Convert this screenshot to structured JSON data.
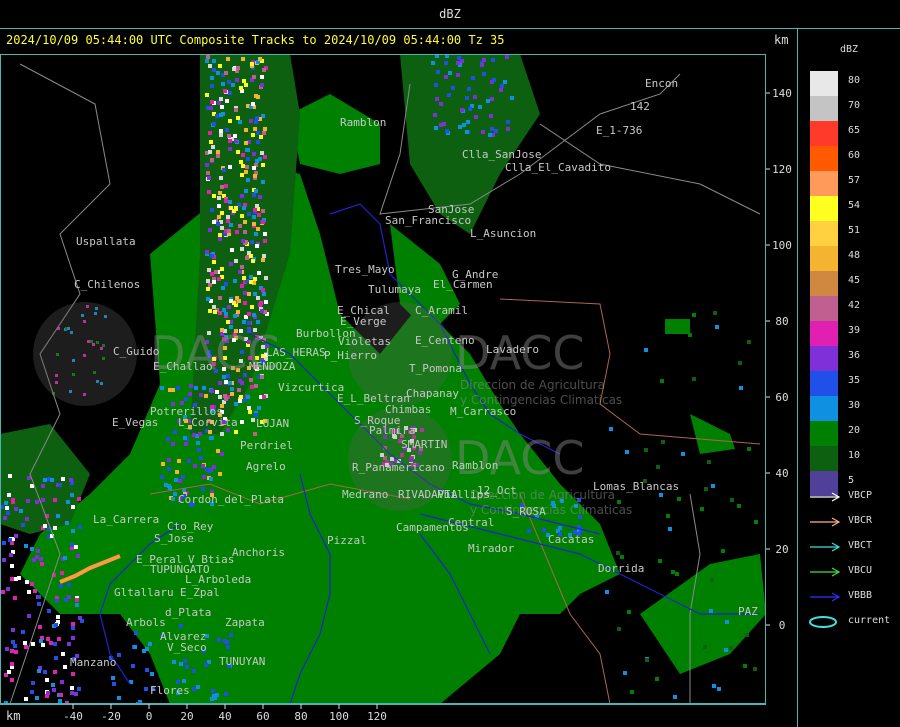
{
  "window": {
    "title": "dBZ"
  },
  "header": {
    "subtitle": "2024/10/09 05:44:00 UTC Composite Tracks to 2024/10/09 05:44:00 Tz 35",
    "km_top": "km",
    "km_bottom": "km"
  },
  "axes": {
    "x_ticks": [
      "-40",
      "-20",
      "0",
      "20",
      "40",
      "60",
      "80",
      "100",
      "120"
    ],
    "y_ticks": [
      "140",
      "120",
      "100",
      "80",
      "60",
      "40",
      "20",
      "0"
    ]
  },
  "legend": {
    "title": "dBZ",
    "scale": [
      {
        "label": "80",
        "color": "#e8e8e8"
      },
      {
        "label": "70",
        "color": "#c4c4c4"
      },
      {
        "label": "65",
        "color": "#ff3a2a"
      },
      {
        "label": "60",
        "color": "#ff5a00"
      },
      {
        "label": "57",
        "color": "#ff9a5a"
      },
      {
        "label": "54",
        "color": "#ffff20"
      },
      {
        "label": "51",
        "color": "#ffd040"
      },
      {
        "label": "48",
        "color": "#f4b430"
      },
      {
        "label": "45",
        "color": "#d08840"
      },
      {
        "label": "42",
        "color": "#c06090"
      },
      {
        "label": "39",
        "color": "#e020b0"
      },
      {
        "label": "36",
        "color": "#8030d8"
      },
      {
        "label": "35",
        "color": "#2050e8"
      },
      {
        "label": "30",
        "color": "#1090e0"
      },
      {
        "label": "20",
        "color": "#008000"
      },
      {
        "label": "10",
        "color": "#0c6010"
      },
      {
        "label": "5",
        "color": "#50409a"
      }
    ],
    "tracks": [
      {
        "label": "VBCP",
        "color": "#ffffff",
        "type": "arrow"
      },
      {
        "label": "VBCR",
        "color": "#ffb080",
        "type": "arrow"
      },
      {
        "label": "VBCT",
        "color": "#40e0e0",
        "type": "arrow"
      },
      {
        "label": "VBCU",
        "color": "#40e040",
        "type": "arrow"
      },
      {
        "label": "VBBB",
        "color": "#3030ff",
        "type": "arrow"
      },
      {
        "label": "current",
        "color": "#40e0e0",
        "type": "ellipse"
      }
    ]
  },
  "places": [
    {
      "name": "Encon"
    },
    {
      "name": "142"
    },
    {
      "name": "E_1-736"
    },
    {
      "name": "Ramblon"
    },
    {
      "name": "Clla_SanJose"
    },
    {
      "name": "Clla_El_Cavadito"
    },
    {
      "name": "SanJose"
    },
    {
      "name": "San_Francisco"
    },
    {
      "name": "L_Asuncion"
    },
    {
      "name": "Uspallata"
    },
    {
      "name": "Tres_Mayo"
    },
    {
      "name": "G_Andre"
    },
    {
      "name": "El_Carmen"
    },
    {
      "name": "C_Chilenos"
    },
    {
      "name": "Tulumaya"
    },
    {
      "name": "E_Chical"
    },
    {
      "name": "E_Verge"
    },
    {
      "name": "C_Aramil"
    },
    {
      "name": "Burbollon"
    },
    {
      "name": "Violetas"
    },
    {
      "name": "P_Hierro"
    },
    {
      "name": "E_Centeno"
    },
    {
      "name": "Lavadero"
    },
    {
      "name": "C_Guido"
    },
    {
      "name": "LAS_HERAS"
    },
    {
      "name": "E_Challao"
    },
    {
      "name": "MENDOZA"
    },
    {
      "name": "Vizcurtica"
    },
    {
      "name": "T_Pomona"
    },
    {
      "name": "E_L_Beltran"
    },
    {
      "name": "Chapanay"
    },
    {
      "name": "Potrerillos"
    },
    {
      "name": "Chimbas"
    },
    {
      "name": "M_Carrasco"
    },
    {
      "name": "E_Vegas"
    },
    {
      "name": "L_Corvita"
    },
    {
      "name": "LUJAN"
    },
    {
      "name": "S_Roque"
    },
    {
      "name": "Palmira"
    },
    {
      "name": "Perdriel"
    },
    {
      "name": "Agrelo"
    },
    {
      "name": "SMARTIN"
    },
    {
      "name": "R_Panamericano"
    },
    {
      "name": "Ramblon"
    },
    {
      "name": "Lomas_Blancas"
    },
    {
      "name": "La_Carrera"
    },
    {
      "name": "Medrano"
    },
    {
      "name": "RIVADAVIA"
    },
    {
      "name": "Phillips"
    },
    {
      "name": "12_Oct"
    },
    {
      "name": "Campamentos"
    },
    {
      "name": "Central"
    },
    {
      "name": "S_ROSA"
    },
    {
      "name": "Cto_Rey"
    },
    {
      "name": "S_Jose"
    },
    {
      "name": "Cacatas"
    },
    {
      "name": "Anchoris"
    },
    {
      "name": "Pizzal"
    },
    {
      "name": "Mirador"
    },
    {
      "name": "E_Peral"
    },
    {
      "name": "V_Btias"
    },
    {
      "name": "TUPUNGATO"
    },
    {
      "name": "L_Arboleda"
    },
    {
      "name": "Dorrida"
    },
    {
      "name": "Gltallaru"
    },
    {
      "name": "E_Zpal"
    },
    {
      "name": "d_Plata"
    },
    {
      "name": "Arbols"
    },
    {
      "name": "Zapata"
    },
    {
      "name": "V_Seco"
    },
    {
      "name": "TUNUYAN"
    },
    {
      "name": "Flores"
    },
    {
      "name": "PAZ"
    },
    {
      "name": "Alvarez"
    },
    {
      "name": "Manzano"
    },
    {
      "name": "Cordon_del_Plata"
    }
  ],
  "watermarks": [
    {
      "text": "DACC"
    },
    {
      "text": "DACC"
    },
    {
      "text": "DACC"
    },
    {
      "text": "Direccion de Agricultura"
    },
    {
      "text": "y Contingencias Climaticas"
    },
    {
      "text": "Direccion de Agricultura"
    },
    {
      "text": "y Contingencias Climaticas"
    }
  ]
}
